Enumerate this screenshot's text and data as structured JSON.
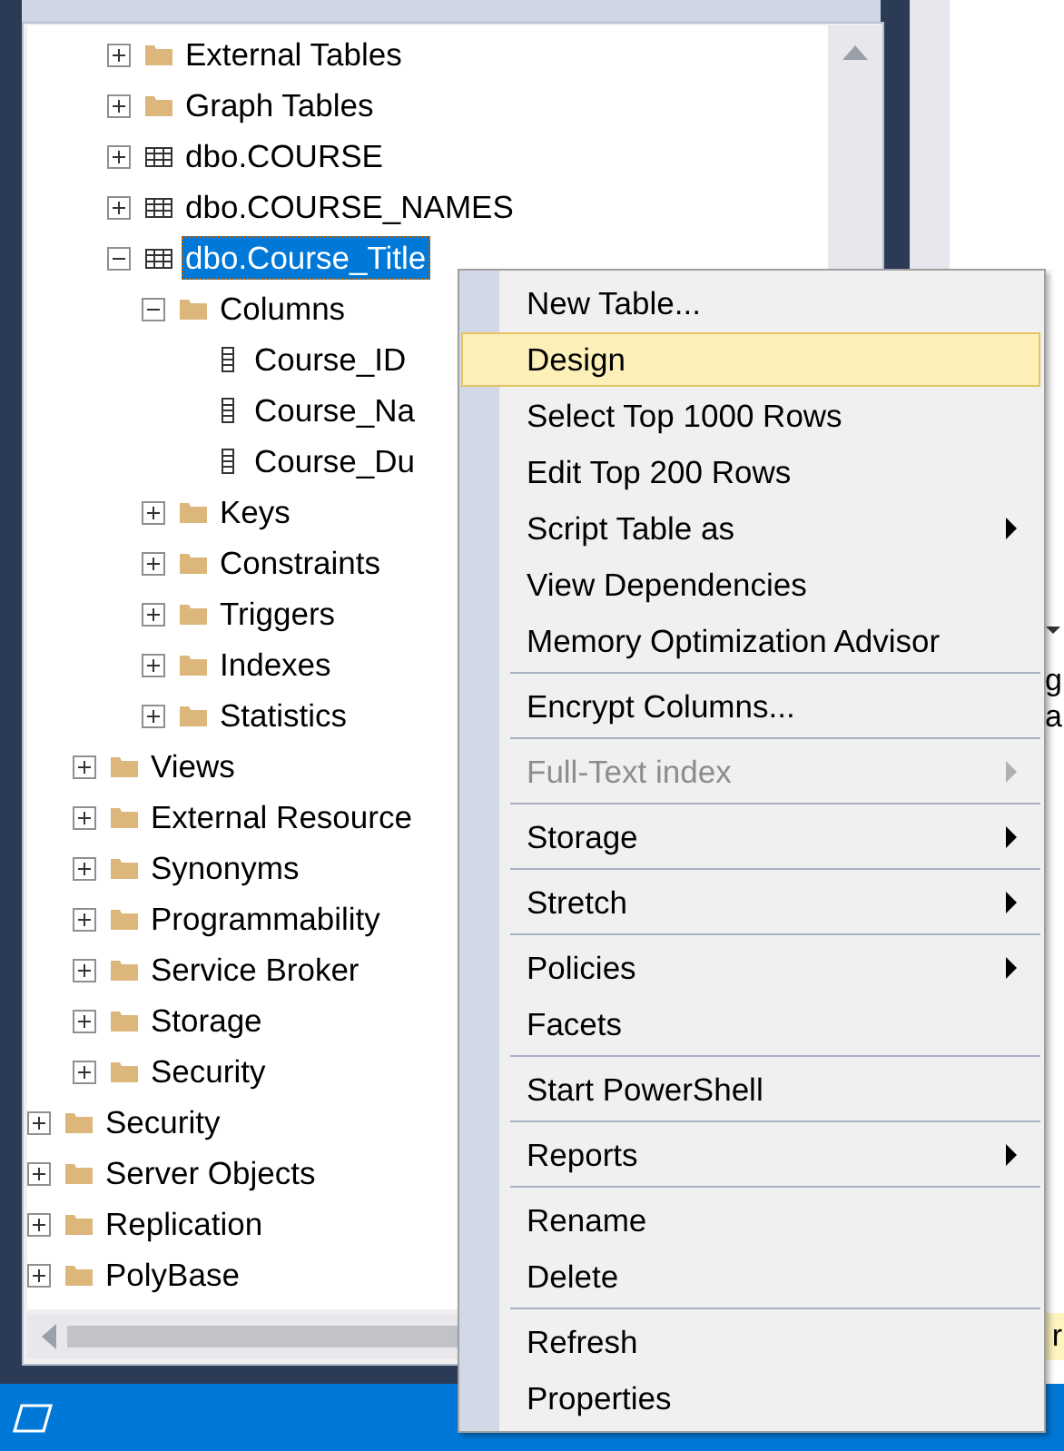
{
  "tree": [
    {
      "children": [
        {
          "children": [
            {
              "children": [
                {
                  "label": "External Tables",
                  "kind": "folder",
                  "expanded": false,
                  "selected": false
                },
                {
                  "label": "Graph Tables",
                  "kind": "folder",
                  "expanded": false,
                  "selected": false
                },
                {
                  "label": "dbo.COURSE",
                  "kind": "table",
                  "expanded": false,
                  "selected": false
                },
                {
                  "label": "dbo.COURSE_NAMES",
                  "kind": "table",
                  "expanded": false,
                  "selected": false
                },
                {
                  "label": "dbo.Course_Title",
                  "kind": "table",
                  "expanded": true,
                  "selected": true,
                  "children": [
                    {
                      "label": "Columns",
                      "kind": "folder",
                      "expanded": true,
                      "selected": false,
                      "children": [
                        {
                          "label": "Course_ID",
                          "kind": "column",
                          "selected": false
                        },
                        {
                          "label": "Course_Na",
                          "kind": "column",
                          "selected": false
                        },
                        {
                          "label": "Course_Du",
                          "kind": "column",
                          "selected": false
                        }
                      ]
                    },
                    {
                      "label": "Keys",
                      "kind": "folder",
                      "expanded": false,
                      "selected": false
                    },
                    {
                      "label": "Constraints",
                      "kind": "folder",
                      "expanded": false,
                      "selected": false
                    },
                    {
                      "label": "Triggers",
                      "kind": "folder",
                      "expanded": false,
                      "selected": false
                    },
                    {
                      "label": "Indexes",
                      "kind": "folder",
                      "expanded": false,
                      "selected": false
                    },
                    {
                      "label": "Statistics",
                      "kind": "folder",
                      "expanded": false,
                      "selected": false
                    }
                  ]
                }
              ]
            },
            {
              "label": "Views",
              "kind": "folder",
              "expanded": false,
              "selected": false
            },
            {
              "label": "External Resource",
              "kind": "folder",
              "expanded": false,
              "selected": false
            },
            {
              "label": "Synonyms",
              "kind": "folder",
              "expanded": false,
              "selected": false
            },
            {
              "label": "Programmability",
              "kind": "folder",
              "expanded": false,
              "selected": false
            },
            {
              "label": "Service Broker",
              "kind": "folder",
              "expanded": false,
              "selected": false
            },
            {
              "label": "Storage",
              "kind": "folder",
              "expanded": false,
              "selected": false
            },
            {
              "label": "Security",
              "kind": "folder",
              "expanded": false,
              "selected": false
            }
          ]
        }
      ]
    },
    {
      "label": "Security",
      "kind": "folder",
      "expanded": false,
      "selected": false
    },
    {
      "label": "Server Objects",
      "kind": "folder",
      "expanded": false,
      "selected": false
    },
    {
      "label": "Replication",
      "kind": "folder",
      "expanded": false,
      "selected": false
    },
    {
      "label": "PolyBase",
      "kind": "folder",
      "expanded": false,
      "selected": false
    }
  ],
  "side_panel": {
    "lines": [
      "g",
      "a"
    ],
    "footer": "r"
  },
  "context_menu": {
    "groups": [
      [
        {
          "label": "New Table...",
          "selected": false,
          "disabled": false,
          "submenu": false
        },
        {
          "label": "Design",
          "selected": true,
          "disabled": false,
          "submenu": false
        },
        {
          "label": "Select Top 1000 Rows",
          "selected": false,
          "disabled": false,
          "submenu": false
        },
        {
          "label": "Edit Top 200 Rows",
          "selected": false,
          "disabled": false,
          "submenu": false
        },
        {
          "label": "Script Table as",
          "selected": false,
          "disabled": false,
          "submenu": true
        },
        {
          "label": "View Dependencies",
          "selected": false,
          "disabled": false,
          "submenu": false
        },
        {
          "label": "Memory Optimization Advisor",
          "selected": false,
          "disabled": false,
          "submenu": false
        }
      ],
      [
        {
          "label": "Encrypt Columns...",
          "selected": false,
          "disabled": false,
          "submenu": false
        }
      ],
      [
        {
          "label": "Full-Text index",
          "selected": false,
          "disabled": true,
          "submenu": true
        }
      ],
      [
        {
          "label": "Storage",
          "selected": false,
          "disabled": false,
          "submenu": true
        }
      ],
      [
        {
          "label": "Stretch",
          "selected": false,
          "disabled": false,
          "submenu": true
        }
      ],
      [
        {
          "label": "Policies",
          "selected": false,
          "disabled": false,
          "submenu": true
        },
        {
          "label": "Facets",
          "selected": false,
          "disabled": false,
          "submenu": false
        }
      ],
      [
        {
          "label": "Start PowerShell",
          "selected": false,
          "disabled": false,
          "submenu": false
        }
      ],
      [
        {
          "label": "Reports",
          "selected": false,
          "disabled": false,
          "submenu": true
        }
      ],
      [
        {
          "label": "Rename",
          "selected": false,
          "disabled": false,
          "submenu": false
        },
        {
          "label": "Delete",
          "selected": false,
          "disabled": false,
          "submenu": false
        }
      ],
      [
        {
          "label": "Refresh",
          "selected": false,
          "disabled": false,
          "submenu": false
        },
        {
          "label": "Properties",
          "selected": false,
          "disabled": false,
          "submenu": false
        }
      ]
    ]
  }
}
